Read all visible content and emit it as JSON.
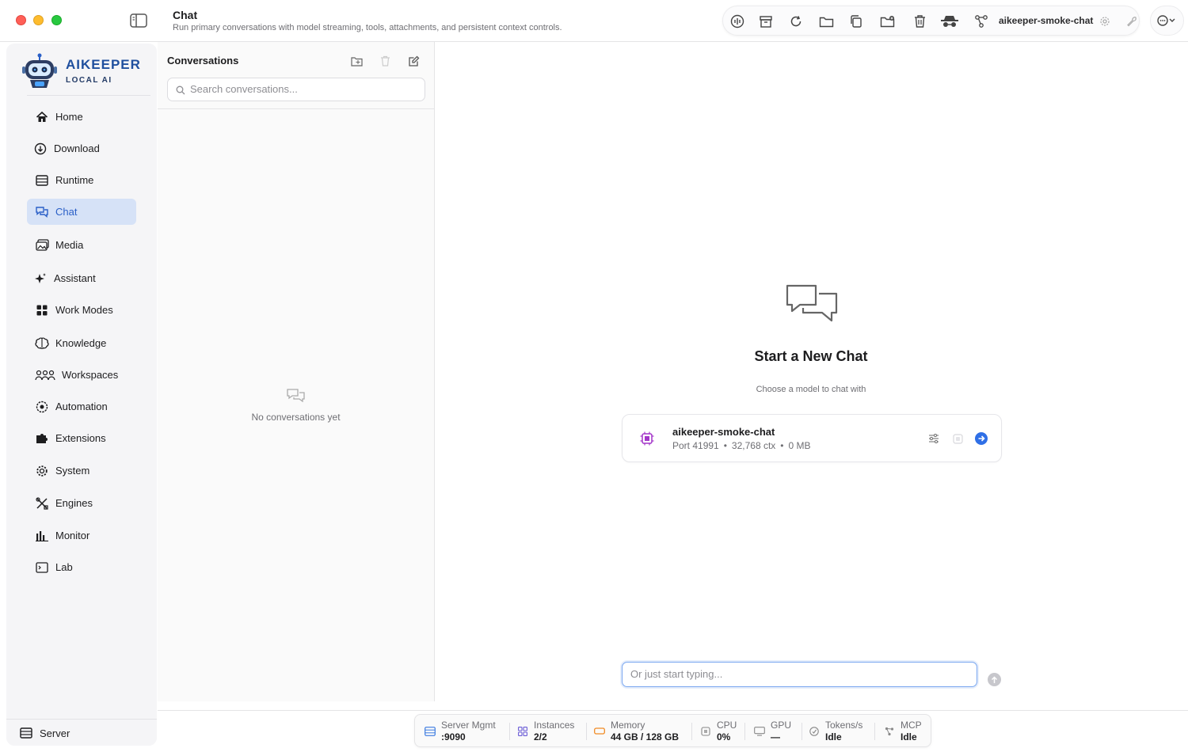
{
  "window": {
    "title": "Chat",
    "subtitle": "Run primary conversations with model streaming, tools, attachments, and persistent context controls."
  },
  "toolbar": {
    "model_name": "aikeeper-smoke-chat",
    "icons": [
      "waveform-icon",
      "archive-icon",
      "refresh-icon",
      "folder-icon",
      "duplicate-icon",
      "folder-add-icon",
      "trash-icon",
      "incognito-icon",
      "network-icon",
      "gear-icon",
      "wrench-icon"
    ]
  },
  "brand": {
    "name": "AIKEEPER",
    "tagline": "LOCAL AI"
  },
  "sidebar": {
    "items": [
      {
        "label": "Home",
        "icon": "house-icon"
      },
      {
        "label": "Download",
        "icon": "download-icon"
      },
      {
        "label": "Runtime",
        "icon": "server-rack-icon"
      },
      {
        "label": "Chat",
        "icon": "chat-bubbles-icon",
        "active": true
      },
      {
        "label": "Media",
        "icon": "photos-icon"
      },
      {
        "label": "Assistant",
        "icon": "sparkle-icon"
      },
      {
        "label": "Work Modes",
        "icon": "grid-icon"
      },
      {
        "label": "Knowledge",
        "icon": "brain-icon"
      },
      {
        "label": "Workspaces",
        "icon": "people-icon"
      },
      {
        "label": "Automation",
        "icon": "eye-gear-icon"
      },
      {
        "label": "Extensions",
        "icon": "puzzle-icon"
      },
      {
        "label": "System",
        "icon": "gear-icon"
      },
      {
        "label": "Engines",
        "icon": "tools-icon"
      },
      {
        "label": "Monitor",
        "icon": "bar-chart-icon"
      },
      {
        "label": "Lab",
        "icon": "terminal-icon"
      }
    ],
    "footer_label": "Server"
  },
  "conversations": {
    "title": "Conversations",
    "search_placeholder": "Search conversations...",
    "empty_text": "No conversations yet"
  },
  "main": {
    "heading": "Start a New Chat",
    "subheading": "Choose a model to chat with",
    "model": {
      "name": "aikeeper-smoke-chat",
      "port": "Port 41991",
      "context": "32,768 ctx",
      "size": "0 MB"
    },
    "composer_placeholder": "Or just start typing..."
  },
  "status": {
    "server_label": "Server Mgmt",
    "server_value": ":9090",
    "instances_label": "Instances",
    "instances_value": "2/2",
    "memory_label": "Memory",
    "memory_value": "44 GB / 128 GB",
    "cpu_label": "CPU",
    "cpu_value": "0%",
    "gpu_label": "GPU",
    "gpu_value": "—",
    "tokens_label": "Tokens/s",
    "tokens_value": "Idle",
    "mcp_label": "MCP",
    "mcp_value": "Idle"
  },
  "colors": {
    "accent": "#2a5fc7",
    "active_nav_bg": "#d6e2f7",
    "brand": "#1f4f9e",
    "send_blue": "#2f6fe6",
    "chip_purple": "#a335c9",
    "memory_orange": "#f08a24"
  }
}
